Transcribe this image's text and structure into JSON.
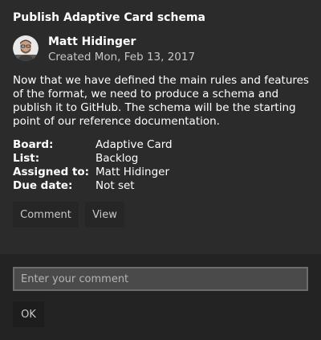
{
  "card": {
    "title": "Publish Adaptive Card schema",
    "author": {
      "name": "Matt Hidinger",
      "created": "Created Mon, Feb 13, 2017"
    },
    "description": "Now that we have defined the main rules and features of the format, we need to produce a schema and publish it to GitHub. The schema will be the starting point of our reference documentation.",
    "facts": [
      {
        "label": "Board:",
        "value": "Adaptive Card"
      },
      {
        "label": "List:",
        "value": "Backlog"
      },
      {
        "label": "Assigned to:",
        "value": "Matt Hidinger"
      },
      {
        "label": "Due date:",
        "value": "Not set"
      }
    ],
    "actions": {
      "comment_label": "Comment",
      "view_label": "View"
    }
  },
  "comment_form": {
    "placeholder": "Enter your comment",
    "value": "",
    "submit_label": "OK"
  },
  "icons": {
    "avatar": "user-avatar-photo"
  },
  "colors": {
    "background": "#2b2b2b",
    "footer_background": "#232323",
    "button_background": "#262626",
    "input_background": "#4a4a4a",
    "input_border": "#6c6c6c"
  }
}
